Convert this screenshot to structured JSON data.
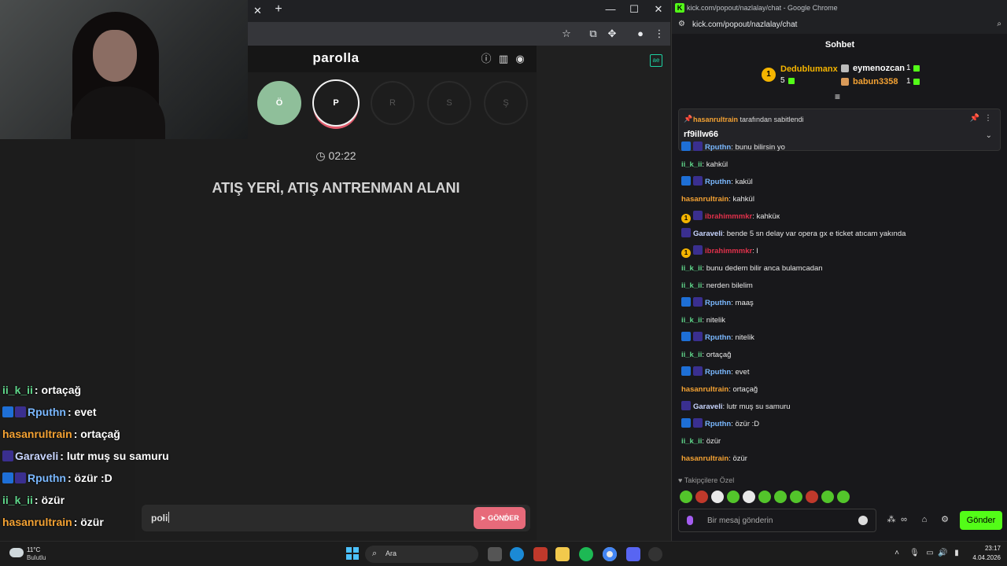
{
  "left_browser": {
    "tab_close": "✕",
    "tab_new": "+",
    "win_minimize": "—",
    "win_maximize": "☐",
    "win_close": "✕"
  },
  "game": {
    "title": "parolla",
    "letters": [
      {
        "label": "Ö",
        "state": "done"
      },
      {
        "label": "P",
        "state": "active"
      },
      {
        "label": "R",
        "state": "idle"
      },
      {
        "label": "S",
        "state": "idle"
      },
      {
        "label": "Ş",
        "state": "idle"
      }
    ],
    "timer": "02:22",
    "question": "ATIŞ YERİ, ATIŞ ANTRENMAN ALANI",
    "answer_value": "poli",
    "send_label": "GÖNDER"
  },
  "overlay_chat": [
    {
      "user": "ii_k_ii",
      "text": ": ortaçağ",
      "color": "#5fd68a",
      "badges": []
    },
    {
      "user": "Rputhn",
      "text": ": evet",
      "color": "#7ab8ff",
      "badges": [
        "blue",
        "star"
      ]
    },
    {
      "user": "hasanrultrain",
      "text": ": ortaçağ",
      "color": "#f4a233",
      "badges": []
    },
    {
      "user": "Garaveli",
      "text": ": lutr muş su samuru",
      "color": "#c9d6ff",
      "badges": [
        "star"
      ]
    },
    {
      "user": "Rputhn",
      "text": ": özür :D",
      "color": "#7ab8ff",
      "badges": [
        "blue",
        "star"
      ]
    },
    {
      "user": "ii_k_ii",
      "text": ": özür",
      "color": "#5fd68a",
      "badges": []
    },
    {
      "user": "hasanrultrain",
      "text": ": özür",
      "color": "#f4a233",
      "badges": []
    }
  ],
  "chat_window": {
    "title": "kick.com/popout/nazlalay/chat - Google Chrome",
    "url": "kick.com/popout/nazlalay/chat",
    "header": "Sohbet",
    "leaderboard": {
      "first": {
        "rank": "1",
        "name": "Dedublumanx",
        "count": "5"
      },
      "second": {
        "name": "eymenozcan",
        "count": "1"
      },
      "third": {
        "name": "babun3358",
        "count": "1"
      }
    },
    "pinned": {
      "by_user": "hasanrultrain",
      "by_suffix": "tarafından sabitlendi",
      "text": "rf9illw66"
    },
    "messages": [
      {
        "user": "Rputhn",
        "text": ": bunu bilirsin yo",
        "color": "#7ab8ff",
        "badges": [
          "blue",
          "star"
        ]
      },
      {
        "user": "ii_k_ii",
        "text": ": kahkül",
        "color": "#5fd68a",
        "badges": []
      },
      {
        "user": "Rputhn",
        "text": ": kakül",
        "color": "#7ab8ff",
        "badges": [
          "blue",
          "star"
        ]
      },
      {
        "user": "hasanrultrain",
        "text": ": kahkül",
        "color": "#f4a233",
        "badges": []
      },
      {
        "user": "ibrahimmmkr",
        "text": ": kahküк",
        "color": "#e0314b",
        "badges": [
          "gold",
          "star"
        ]
      },
      {
        "user": "Garaveli",
        "text": ": bende 5 sn delay var opera gx e ticket atıcam yakında",
        "color": "#c9d6ff",
        "badges": [
          "star"
        ]
      },
      {
        "user": "ibrahimmmkr",
        "text": ": l",
        "color": "#e0314b",
        "badges": [
          "gold",
          "star"
        ]
      },
      {
        "user": "ii_k_ii",
        "text": ": bunu dedem bilir anca bulamcadan",
        "color": "#5fd68a",
        "badges": []
      },
      {
        "user": "ii_k_ii",
        "text": ": nerden bilelim",
        "color": "#5fd68a",
        "badges": []
      },
      {
        "user": "Rputhn",
        "text": ": maaş",
        "color": "#7ab8ff",
        "badges": [
          "blue",
          "star"
        ]
      },
      {
        "user": "ii_k_ii",
        "text": ": nitelik",
        "color": "#5fd68a",
        "badges": []
      },
      {
        "user": "Rputhn",
        "text": ": nitelik",
        "color": "#7ab8ff",
        "badges": [
          "blue",
          "star"
        ]
      },
      {
        "user": "ii_k_ii",
        "text": ": ortaçağ",
        "color": "#5fd68a",
        "badges": []
      },
      {
        "user": "Rputhn",
        "text": ": evet",
        "color": "#7ab8ff",
        "badges": [
          "blue",
          "star"
        ]
      },
      {
        "user": "hasanrultrain",
        "text": ": ortaçağ",
        "color": "#f4a233",
        "badges": []
      },
      {
        "user": "Garaveli",
        "text": ": lutr muş su samuru",
        "color": "#c9d6ff",
        "badges": [
          "star"
        ]
      },
      {
        "user": "Rputhn",
        "text": ": özür :D",
        "color": "#7ab8ff",
        "badges": [
          "blue",
          "star"
        ]
      },
      {
        "user": "ii_k_ii",
        "text": ": özür",
        "color": "#5fd68a",
        "badges": []
      },
      {
        "user": "hasanrultrain",
        "text": ": özür",
        "color": "#f4a233",
        "badges": []
      }
    ],
    "followers_only": "Takipçilere Özel",
    "emotes": [
      "green",
      "red",
      "white",
      "green",
      "white",
      "green",
      "green",
      "green",
      "red",
      "green",
      "green"
    ],
    "input_placeholder": "Bir mesaj gönderin",
    "send_label": "Gönder"
  },
  "taskbar": {
    "weather_temp": "11°C",
    "weather_desc": "Bulutlu",
    "search_label": "Ara",
    "time": "23:17",
    "date": "4.04.2026"
  },
  "colors": {
    "kick_green": "#53fc18",
    "send_pink": "#e76a7a",
    "done_green": "#8fbf9a"
  }
}
